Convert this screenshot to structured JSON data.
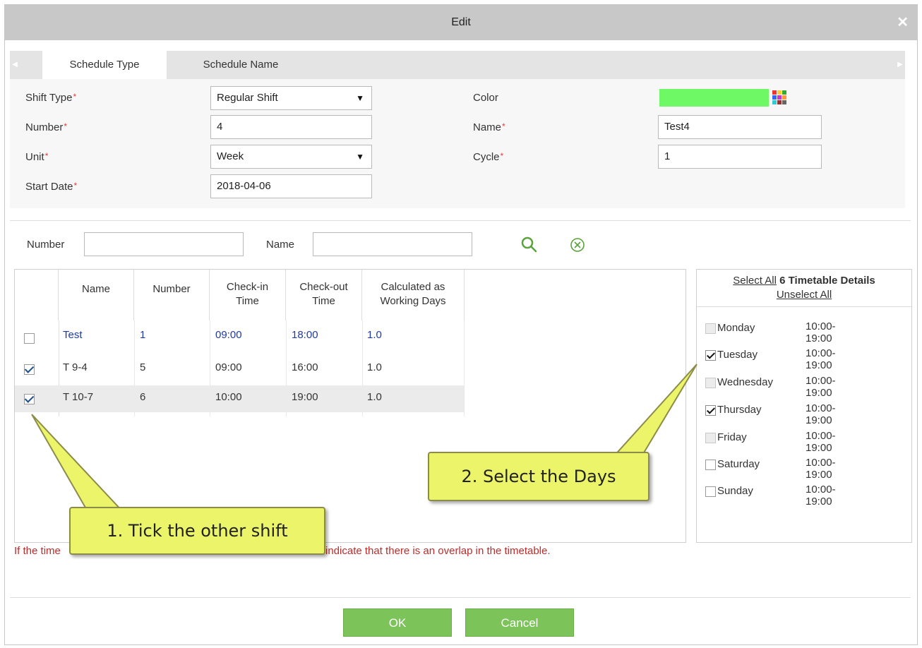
{
  "dialog": {
    "title": "Edit",
    "close_icon": "✕"
  },
  "tabs": [
    {
      "label": "Schedule Type",
      "active": true
    },
    {
      "label": "Schedule Name",
      "active": false
    }
  ],
  "form": {
    "shift_type": {
      "label": "Shift Type",
      "value": "Regular Shift"
    },
    "number": {
      "label": "Number",
      "value": "4"
    },
    "unit": {
      "label": "Unit",
      "value": "Week"
    },
    "start_date": {
      "label": "Start Date",
      "value": "2018-04-06"
    },
    "color": {
      "label": "Color",
      "value": "#6ef865"
    },
    "name": {
      "label": "Name",
      "value": "Test4"
    },
    "cycle": {
      "label": "Cycle",
      "value": "1"
    }
  },
  "filter": {
    "number_label": "Number",
    "number_value": "",
    "name_label": "Name",
    "name_value": "",
    "search_icon": "search-icon",
    "clear_icon": "clear-icon"
  },
  "table": {
    "headers": [
      "Name",
      "Number",
      "Check-in Time",
      "Check-out Time",
      "Calculated as Working Days"
    ],
    "rows": [
      {
        "checked": false,
        "name": "Test",
        "number": "1",
        "check_in": "09:00",
        "check_out": "18:00",
        "working_days": "1.0",
        "highlight": "blue"
      },
      {
        "checked": true,
        "name": "T 9-4",
        "number": "5",
        "check_in": "09:00",
        "check_out": "16:00",
        "working_days": "1.0"
      },
      {
        "checked": true,
        "name": "T 10-7",
        "number": "6",
        "check_in": "10:00",
        "check_out": "19:00",
        "working_days": "1.0"
      }
    ]
  },
  "timetable": {
    "select_all": "Select All",
    "title": "6 Timetable Details",
    "unselect_all": "Unselect All",
    "days": [
      {
        "day": "Monday",
        "time": "10:00-19:00",
        "checked": false
      },
      {
        "day": "Tuesday",
        "time": "10:00-19:00",
        "checked": true
      },
      {
        "day": "Wednesday",
        "time": "10:00-19:00",
        "checked": false
      },
      {
        "day": "Thursday",
        "time": "10:00-19:00",
        "checked": true
      },
      {
        "day": "Friday",
        "time": "10:00-19:00",
        "checked": false
      },
      {
        "day": "Saturday",
        "time": "10:00-19:00",
        "checked": false
      },
      {
        "day": "Sunday",
        "time": "10:00-19:00",
        "checked": false
      }
    ]
  },
  "warning": {
    "left": "If the time",
    "right": "indicate that there is an overlap in the timetable."
  },
  "callouts": {
    "tick": "1. Tick the other shift",
    "select": "2. Select the Days"
  },
  "buttons": {
    "ok": "OK",
    "cancel": "Cancel"
  },
  "colors": {
    "accent_green": "#7cc35a",
    "warning_red": "#c22a2a",
    "callout_yellow": "#ecf56a",
    "row_blue": "#1f3aa8"
  }
}
